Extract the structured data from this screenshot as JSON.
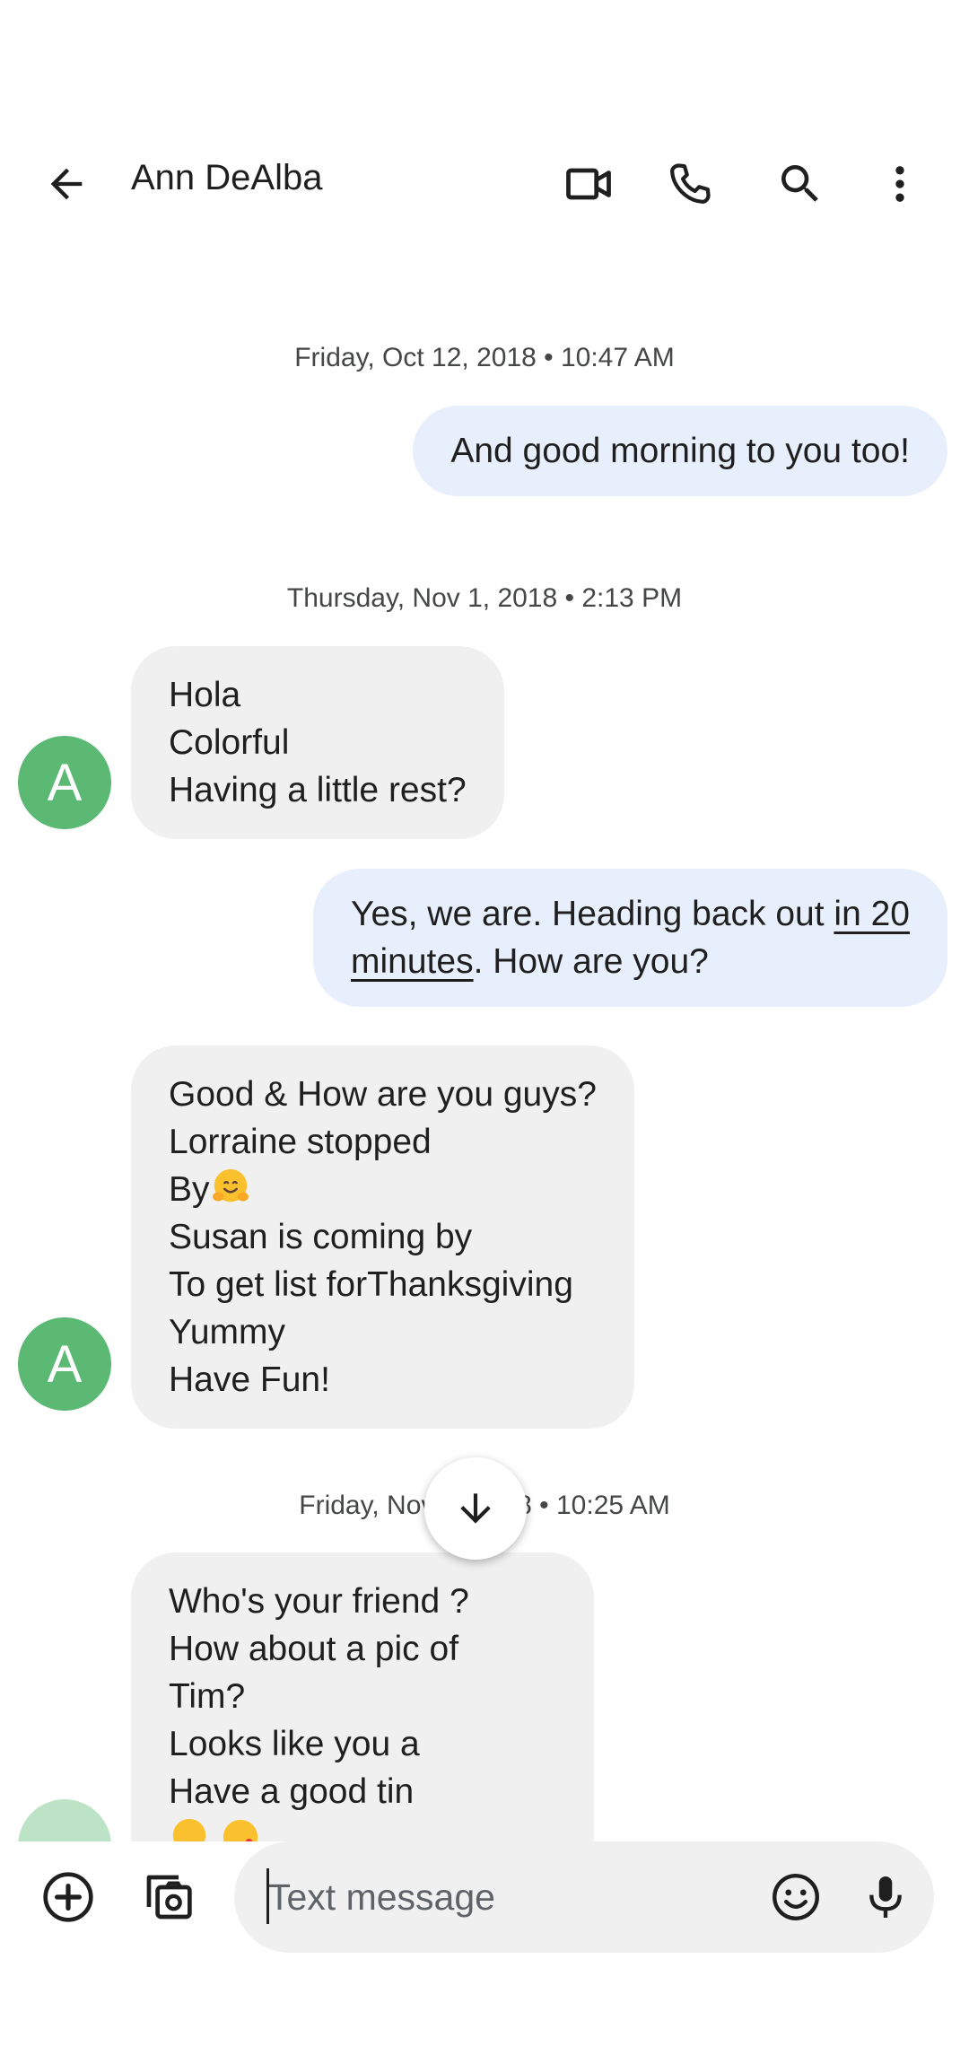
{
  "header": {
    "contact_name": "Ann DeAlba",
    "icons": [
      "back-arrow-icon",
      "video-call-icon",
      "phone-icon",
      "search-icon",
      "more-vert-icon"
    ]
  },
  "conversation": {
    "date_separators": [
      "Friday, Oct 12, 2018 • 10:47 AM",
      "Thursday, Nov 1, 2018 • 2:13 PM",
      "Friday, Nov 2, 2018 • 10:25 AM"
    ],
    "messages": [
      {
        "direction": "outgoing",
        "lines": [
          "And good morning to you too!"
        ]
      },
      {
        "direction": "incoming",
        "sender_initial": "A",
        "lines": [
          "Hola",
          "Colorful",
          "Having a little rest?"
        ]
      },
      {
        "direction": "outgoing",
        "line1_before_link": "Yes, we are. Heading back out ",
        "line1_link": "in 20",
        "line2_link": "minutes",
        "line2_after_link": ". How are you?"
      },
      {
        "direction": "incoming",
        "sender_initial": "A",
        "lines": [
          "Good & How are you guys?",
          "Lorraine stopped",
          "By",
          "Susan is coming by",
          "To get list forThanksgiving",
          "Yummy",
          "Have Fun!"
        ],
        "emoji": "hugging-face-emoji"
      },
      {
        "direction": "incoming",
        "lines": [
          "Who's your friend ?",
          "How about a pic of",
          "Tim?",
          "Looks like you a",
          "Have a good tin"
        ],
        "emoji": [
          "hugging-face-emoji",
          "winking-kiss-emoji"
        ]
      }
    ]
  },
  "scroll_button": {
    "icon": "arrow-down-icon"
  },
  "compose": {
    "placeholder": "Text message",
    "value": "",
    "icons": [
      "add-circle-icon",
      "gallery-camera-icon",
      "emoji-icon",
      "microphone-icon"
    ]
  },
  "colors": {
    "incoming_bubble": "#f0f0f0",
    "outgoing_bubble": "#e8effc",
    "avatar": "#5bb974",
    "compose_field": "#f0f0f0",
    "text": "#1f1f1f",
    "secondary_text": "#444746"
  }
}
